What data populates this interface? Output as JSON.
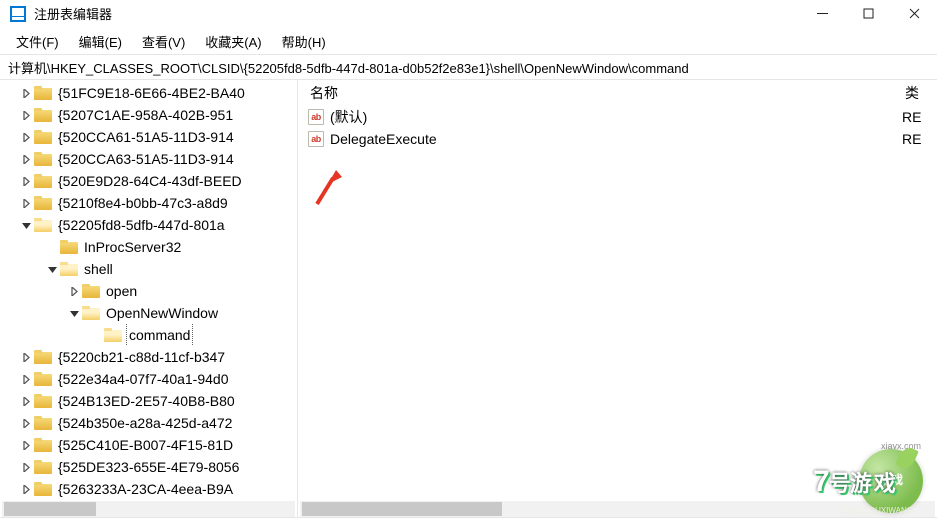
{
  "window": {
    "title": "注册表编辑器"
  },
  "menu": {
    "file": "文件(F)",
    "edit": "编辑(E)",
    "view": "查看(V)",
    "favorites": "收藏夹(A)",
    "help": "帮助(H)"
  },
  "address": {
    "path": "计算机\\HKEY_CLASSES_ROOT\\CLSID\\{52205fd8-5dfb-447d-801a-d0b52f2e83e1}\\shell\\OpenNewWindow\\command"
  },
  "tree": {
    "nodes": [
      {
        "name": "{51FC9E18-6E66-4BE2-BA40",
        "depth": 1,
        "expand": "closed"
      },
      {
        "name": "{5207C1AE-958A-402B-951",
        "depth": 1,
        "expand": "closed"
      },
      {
        "name": "{520CCA61-51A5-11D3-914",
        "depth": 1,
        "expand": "closed"
      },
      {
        "name": "{520CCA63-51A5-11D3-914",
        "depth": 1,
        "expand": "closed"
      },
      {
        "name": "{520E9D28-64C4-43df-BEED",
        "depth": 1,
        "expand": "closed"
      },
      {
        "name": "{5210f8e4-b0bb-47c3-a8d9",
        "depth": 1,
        "expand": "closed"
      },
      {
        "name": "{52205fd8-5dfb-447d-801a",
        "depth": 1,
        "expand": "open",
        "open": true
      },
      {
        "name": "InProcServer32",
        "depth": 2,
        "expand": "none"
      },
      {
        "name": "shell",
        "depth": 2,
        "expand": "open",
        "open": true
      },
      {
        "name": "open",
        "depth": 3,
        "expand": "closed"
      },
      {
        "name": "OpenNewWindow",
        "depth": 3,
        "expand": "open",
        "open": true
      },
      {
        "name": "command",
        "depth": 4,
        "expand": "none",
        "selected": true,
        "open": true
      },
      {
        "name": "{5220cb21-c88d-11cf-b347",
        "depth": 1,
        "expand": "closed"
      },
      {
        "name": "{522e34a4-07f7-40a1-94d0",
        "depth": 1,
        "expand": "closed"
      },
      {
        "name": "{524B13ED-2E57-40B8-B80",
        "depth": 1,
        "expand": "closed"
      },
      {
        "name": "{524b350e-a28a-425d-a472",
        "depth": 1,
        "expand": "closed"
      },
      {
        "name": "{525C410E-B007-4F15-81D",
        "depth": 1,
        "expand": "closed"
      },
      {
        "name": "{525DE323-655E-4E79-8056",
        "depth": 1,
        "expand": "closed"
      },
      {
        "name": "{5263233A-23CA-4eea-B9A",
        "depth": 1,
        "expand": "closed"
      }
    ]
  },
  "list": {
    "header": {
      "name": "名称",
      "type": "类"
    },
    "rows": [
      {
        "name": "(默认)",
        "type": "RE"
      },
      {
        "name": "DelegateExecute",
        "type": "RE"
      }
    ]
  },
  "watermark": {
    "brand_num": "7",
    "brand_suffix": "号",
    "brand_word": "游戏",
    "inner_top": "游戏",
    "url": "xiayx.com",
    "small": "ZHAOYOUXIWANG"
  }
}
